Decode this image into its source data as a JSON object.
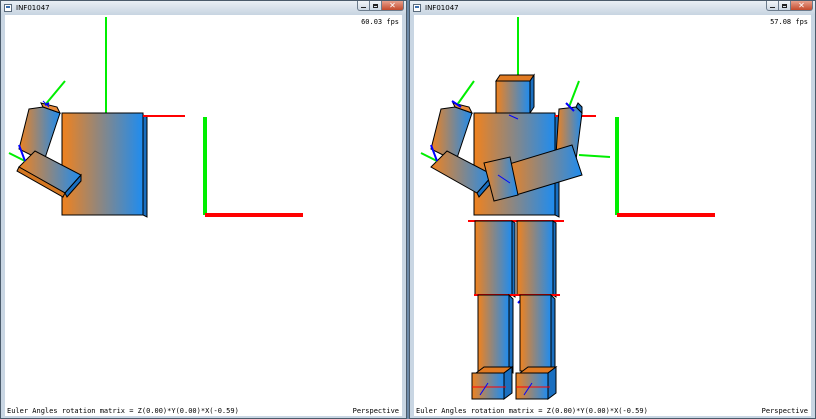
{
  "colors": {
    "gradient_orange": "#f0821e",
    "gradient_blue": "#1e8cf0",
    "axis_x": "#ff0000",
    "axis_y": "#00ee00",
    "axis_z": "#0000ff"
  },
  "windows": [
    {
      "title": "INF01047",
      "fps": "60.03 fps",
      "status": "Euler Angles rotation matrix = Z(0.00)*Y(0.00)*X(-0.59)",
      "projection": "Perspective"
    },
    {
      "title": "INF01047",
      "fps": "57.08 fps",
      "status": "Euler Angles rotation matrix = Z(0.00)*Y(0.00)*X(-0.59)",
      "projection": "Perspective"
    }
  ],
  "icons": {
    "minimize": "minimize-icon",
    "maximize": "maximize-icon",
    "close": "close-icon"
  }
}
